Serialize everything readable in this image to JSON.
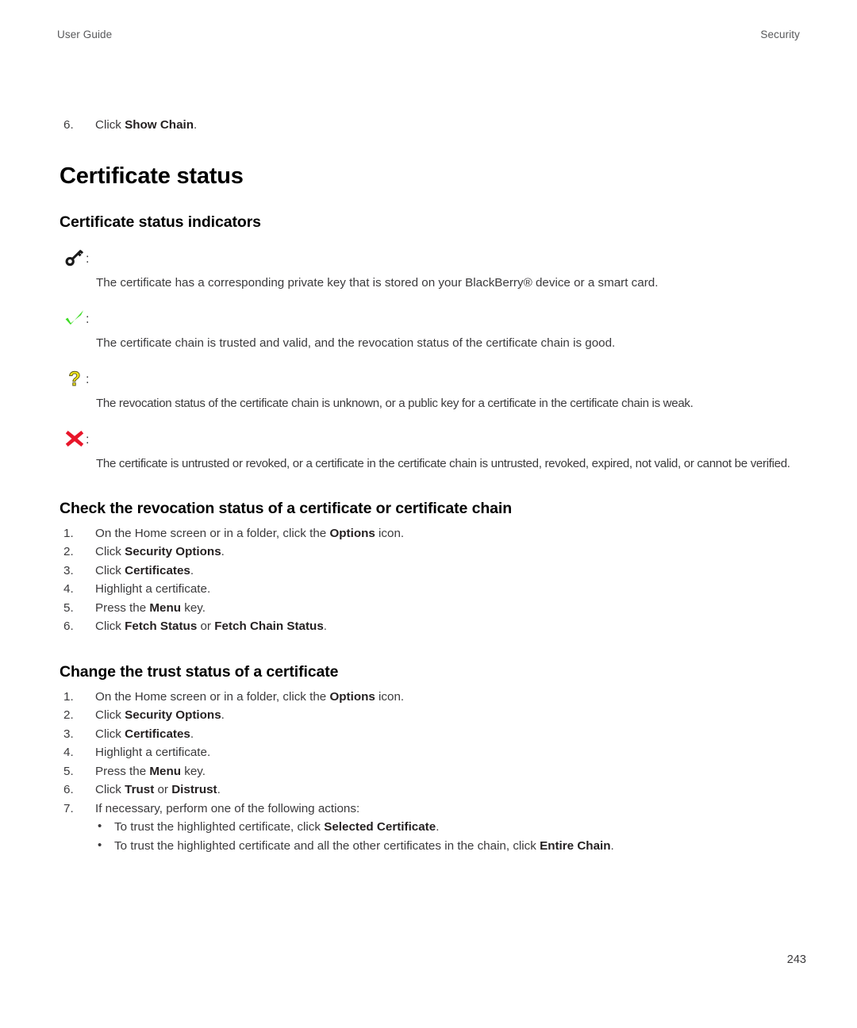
{
  "header": {
    "left": "User Guide",
    "right": "Security"
  },
  "top_step": {
    "num": "6.",
    "pre": "Click ",
    "bold": "Show Chain",
    "post": "."
  },
  "title": "Certificate status",
  "sections": [
    {
      "heading": "Certificate status indicators",
      "indicators": [
        {
          "icon": "key-icon",
          "icon_color": "#1a1a1a",
          "colon": ":",
          "text": "The certificate has a corresponding private key that is stored on your BlackBerry® device or a smart card."
        },
        {
          "icon": "check-icon",
          "icon_color": "#3ddc24",
          "colon": ":",
          "text": "The certificate chain is trusted and valid, and the revocation status of the certificate chain is good."
        },
        {
          "icon": "question-icon",
          "icon_color": "#f2e61c",
          "colon": ":",
          "text": "The revocation status of the certificate chain is unknown, or a public key for a certificate in the certificate chain is weak."
        },
        {
          "icon": "cross-icon",
          "icon_color": "#e8162a",
          "colon": ":",
          "text": "The certificate is untrusted or revoked, or a certificate in the certificate chain is untrusted, revoked, expired, not valid, or cannot be verified."
        }
      ]
    },
    {
      "heading": "Check the revocation status of a certificate or certificate chain",
      "steps": [
        {
          "num": "1.",
          "parts": [
            {
              "t": "On the Home screen or in a folder, click the ",
              "b": false
            },
            {
              "t": "Options",
              "b": true
            },
            {
              "t": " icon.",
              "b": false
            }
          ]
        },
        {
          "num": "2.",
          "parts": [
            {
              "t": "Click ",
              "b": false
            },
            {
              "t": "Security Options",
              "b": true
            },
            {
              "t": ".",
              "b": false
            }
          ]
        },
        {
          "num": "3.",
          "parts": [
            {
              "t": "Click ",
              "b": false
            },
            {
              "t": "Certificates",
              "b": true
            },
            {
              "t": ".",
              "b": false
            }
          ]
        },
        {
          "num": "4.",
          "parts": [
            {
              "t": "Highlight a certificate.",
              "b": false
            }
          ]
        },
        {
          "num": "5.",
          "parts": [
            {
              "t": "Press the ",
              "b": false
            },
            {
              "t": "Menu",
              "b": true
            },
            {
              "t": " key.",
              "b": false
            }
          ]
        },
        {
          "num": "6.",
          "parts": [
            {
              "t": "Click ",
              "b": false
            },
            {
              "t": "Fetch Status",
              "b": true
            },
            {
              "t": " or ",
              "b": false
            },
            {
              "t": "Fetch Chain Status",
              "b": true
            },
            {
              "t": ".",
              "b": false
            }
          ]
        }
      ]
    },
    {
      "heading": "Change the trust status of a certificate",
      "steps": [
        {
          "num": "1.",
          "parts": [
            {
              "t": "On the Home screen or in a folder, click the ",
              "b": false
            },
            {
              "t": "Options",
              "b": true
            },
            {
              "t": " icon.",
              "b": false
            }
          ]
        },
        {
          "num": "2.",
          "parts": [
            {
              "t": "Click ",
              "b": false
            },
            {
              "t": "Security Options",
              "b": true
            },
            {
              "t": ".",
              "b": false
            }
          ]
        },
        {
          "num": "3.",
          "parts": [
            {
              "t": "Click ",
              "b": false
            },
            {
              "t": "Certificates",
              "b": true
            },
            {
              "t": ".",
              "b": false
            }
          ]
        },
        {
          "num": "4.",
          "parts": [
            {
              "t": "Highlight a certificate.",
              "b": false
            }
          ]
        },
        {
          "num": "5.",
          "parts": [
            {
              "t": "Press the ",
              "b": false
            },
            {
              "t": "Menu",
              "b": true
            },
            {
              "t": " key.",
              "b": false
            }
          ]
        },
        {
          "num": "6.",
          "parts": [
            {
              "t": "Click ",
              "b": false
            },
            {
              "t": "Trust",
              "b": true
            },
            {
              "t": " or ",
              "b": false
            },
            {
              "t": "Distrust",
              "b": true
            },
            {
              "t": ".",
              "b": false
            }
          ]
        },
        {
          "num": "7.",
          "parts": [
            {
              "t": "If necessary, perform one of the following actions:",
              "b": false
            }
          ]
        }
      ],
      "bullets": [
        {
          "dot": "•",
          "parts": [
            {
              "t": "To trust the highlighted certificate, click ",
              "b": false
            },
            {
              "t": "Selected Certificate",
              "b": true
            },
            {
              "t": ".",
              "b": false
            }
          ]
        },
        {
          "dot": "•",
          "parts": [
            {
              "t": "To trust the highlighted certificate and all the other certificates in the chain, click ",
              "b": false
            },
            {
              "t": "Entire Chain",
              "b": true
            },
            {
              "t": ".",
              "b": false
            }
          ]
        }
      ]
    }
  ],
  "page_number": "243"
}
